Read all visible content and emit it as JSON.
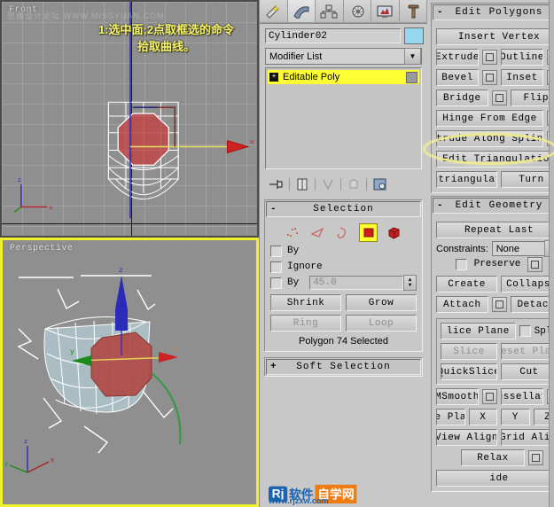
{
  "viewports": {
    "front": {
      "label": "Front",
      "watermark": "思缘设计论坛 WWW.MISSYUAN.COM",
      "annotation_line1": "1:选中面;2点取框选的命令",
      "annotation_line2": "拾取曲线。"
    },
    "perspective": {
      "label": "Perspective"
    },
    "axis": {
      "x": "x",
      "y": "y",
      "z": "z"
    }
  },
  "command_panel": {
    "tabs": [
      {
        "name": "create-tab",
        "icon": "star-wand-icon"
      },
      {
        "name": "modify-tab",
        "icon": "bent-arc-icon"
      },
      {
        "name": "hierarchy-tab",
        "icon": "tree-nodes-icon"
      },
      {
        "name": "motion-tab",
        "icon": "wheel-icon"
      },
      {
        "name": "display-tab",
        "icon": "monitor-icon"
      },
      {
        "name": "utilities-tab",
        "icon": "hammer-icon"
      }
    ],
    "object_name": "Cylinder02",
    "color_swatch": "#96d6ee",
    "modifier_list_label": "Modifier List",
    "stack": [
      {
        "label": "Editable Poly",
        "highlight": "#ffff33"
      }
    ],
    "stack_tools": [
      "pin-stack-icon",
      "show-end-result-icon",
      "make-unique-icon",
      "remove-modifier-icon",
      "configure-modifier-sets-icon"
    ]
  },
  "selection": {
    "title": "Selection",
    "sign": "-",
    "subobject_icons": [
      {
        "name": "vertex-icon",
        "selected": false
      },
      {
        "name": "edge-icon",
        "selected": false
      },
      {
        "name": "border-icon",
        "selected": false
      },
      {
        "name": "polygon-icon",
        "selected": true
      },
      {
        "name": "element-icon",
        "selected": false
      }
    ],
    "by_vertex_label": "By",
    "ignore_backfacing_label": "Ignore",
    "by_angle_label": "By",
    "by_angle_value": "45.0",
    "shrink_label": "Shrink",
    "grow_label": "Grow",
    "ring_label": "Ring",
    "loop_label": "Loop",
    "status": "Polygon 74 Selected"
  },
  "soft_selection": {
    "title": "Soft Selection",
    "sign": "+"
  },
  "edit_polygons": {
    "title": "Edit Polygons",
    "sign": "-",
    "insert_vertex": "Insert Vertex",
    "extrude": "Extrude",
    "outline": "Outline",
    "bevel": "Bevel",
    "inset": "Inset",
    "bridge": "Bridge",
    "flip": "Flip",
    "hinge_from_edge": "Hinge From Edge",
    "extrude_along_spline": "xtrude Along Spline",
    "edit_triangulation": "Edit Triangulation",
    "retriangulate": "etriangulat",
    "turn": "Turn"
  },
  "edit_geometry": {
    "title": "Edit Geometry",
    "sign": "-",
    "repeat_last": "Repeat Last",
    "constraints_label": "Constraints:",
    "constraints_value": "None",
    "preserve_label": "Preserve",
    "create": "Create",
    "collapse": "Collapse",
    "attach": "Attach",
    "detach": "Detach",
    "slice_plane": "lice Plane",
    "split_label": "Spli",
    "slice": "Slice",
    "reset_plane": "eset Plan",
    "quickslice": "QuickSlice",
    "cut": "Cut",
    "msmooth": "MSmooth",
    "tessellate": "essellat",
    "make_planar": "Make Planar",
    "axis_x": "X",
    "axis_y": "Y",
    "axis_z": "Z",
    "view_align": "View Align",
    "grid_align": "Grid Align",
    "relax": "Relax",
    "hide_selected": "ide"
  },
  "watermark": {
    "logo_mark": "Rj",
    "text_blue": "软件",
    "text_orange": "自学网",
    "url": "www.rjzxw.com"
  }
}
